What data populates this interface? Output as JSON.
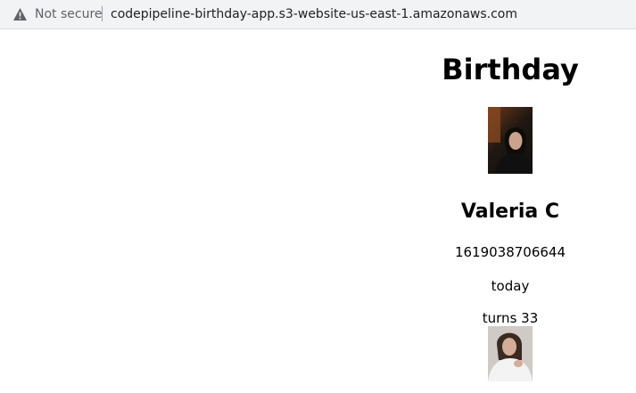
{
  "browser": {
    "security_icon": "warning-triangle-icon",
    "security_label": "Not secure",
    "url": "codepipeline-birthday-app.s3-website-us-east-1.amazonaws.com"
  },
  "page": {
    "title": "Birthday",
    "person": {
      "photo": "portrait-photo-dark",
      "name": "Valeria C",
      "timestamp": "1619038706644",
      "when": "today",
      "age_text": "turns 33"
    },
    "next_person": {
      "photo": "portrait-photo-light"
    }
  }
}
